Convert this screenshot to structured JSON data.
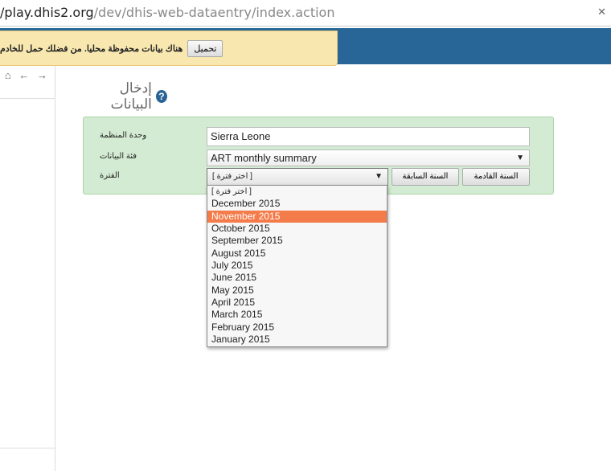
{
  "browser": {
    "url_host": "/play.dhis2.org",
    "url_path": "/dev/dhis-web-dataentry/index.action",
    "close": "✕"
  },
  "banner": {
    "upload_button": "تحميل",
    "message": "هناك بيانات محفوظة محليا. من فضلك حمل للخادم"
  },
  "sidebar": {
    "nav": "⌂ ← →"
  },
  "page": {
    "title": "إدخال البيانات",
    "help": "?"
  },
  "form": {
    "org_unit_label": "وحدة المنظمة",
    "org_unit_value": "Sierra Leone",
    "dataset_label": "فئة البيانات",
    "dataset_value": "ART monthly summary",
    "period_label": "الفترة",
    "period_value": "[ اختر فترة ]",
    "prev_year": "السنة السابقة",
    "next_year": "السنة القادمة"
  },
  "period_options": [
    "[ اختر فترة ]",
    "December 2015",
    "November 2015",
    "October 2015",
    "September 2015",
    "August 2015",
    "July 2015",
    "June 2015",
    "May 2015",
    "April 2015",
    "March 2015",
    "February 2015",
    "January 2015"
  ],
  "highlighted_option": 2,
  "colors": {
    "header": "#276696",
    "banner": "#f8e8b0",
    "form_bg": "#d3ebd2",
    "highlight": "#f47b4a"
  }
}
